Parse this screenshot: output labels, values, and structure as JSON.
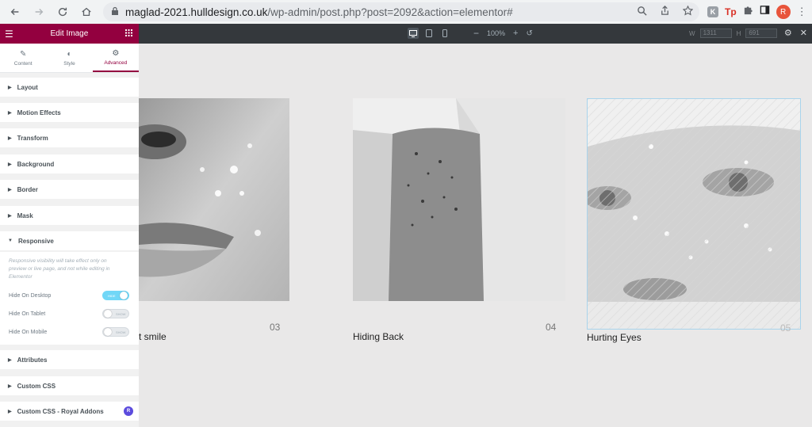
{
  "browser": {
    "url_domain": "maglad-2021.hulldesign.co.uk",
    "url_path": "/wp-admin/post.php?post=2092&action=elementor#",
    "avatar_letter": "R",
    "ext_tp": "Tp",
    "ext_k": "K"
  },
  "topbar": {
    "zoom": "100%",
    "w_label": "W",
    "w_value": "1311",
    "h_label": "H",
    "h_value": "691"
  },
  "panel": {
    "title": "Edit Image",
    "tabs": [
      {
        "label": "Content",
        "icon": "pencil-icon"
      },
      {
        "label": "Style",
        "icon": "half-circle-icon"
      },
      {
        "label": "Advanced",
        "icon": "gear-icon",
        "active": true
      }
    ],
    "sections": [
      "Layout",
      "Motion Effects",
      "Transform",
      "Background",
      "Border",
      "Mask",
      "Responsive",
      "Attributes",
      "Custom CSS",
      "Custom CSS - Royal Addons"
    ],
    "responsive_note": "Responsive visibility will take effect only on preview or live page, and not while editing in Elementor",
    "toggles": [
      {
        "label": "Hide On Desktop",
        "state": "HIDE",
        "on": true
      },
      {
        "label": "Hide On Tablet",
        "state": "SHOW",
        "on": false
      },
      {
        "label": "Hide On Mobile",
        "state": "SHOW",
        "on": false
      }
    ],
    "royal_badge": "R"
  },
  "canvas": {
    "cards": [
      {
        "number": "03",
        "caption": "t smile"
      },
      {
        "number": "04",
        "caption": "Hiding Back"
      },
      {
        "number": "05",
        "caption": "Hurting Eyes"
      }
    ]
  }
}
